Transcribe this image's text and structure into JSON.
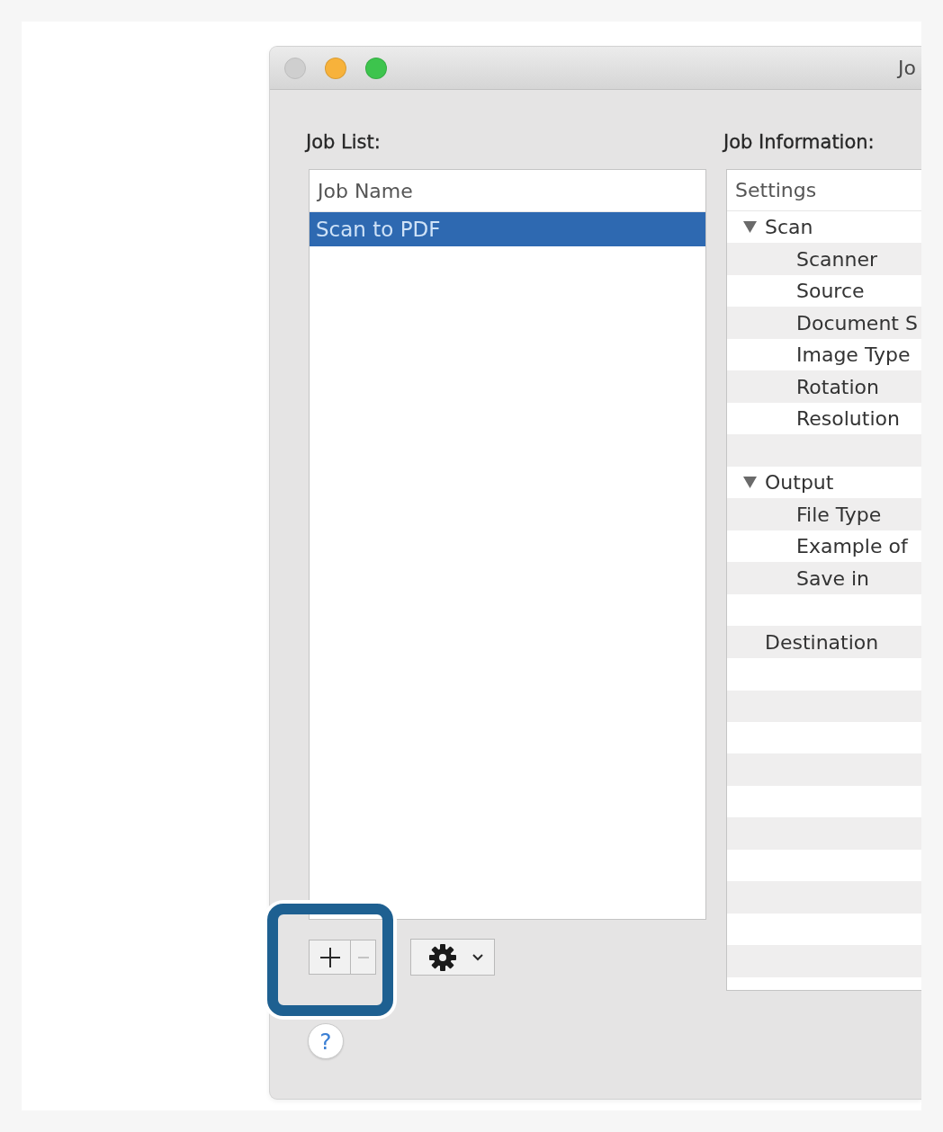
{
  "window": {
    "title": "Jo",
    "controls": [
      {
        "kind": "close",
        "disabled": true
      },
      {
        "kind": "minimize",
        "disabled": false
      },
      {
        "kind": "zoom",
        "disabled": false
      }
    ]
  },
  "job_list": {
    "label": "Job List:",
    "columns": [
      "Job Name"
    ],
    "rows": [
      {
        "name": "Scan to PDF",
        "selected": true
      }
    ]
  },
  "list_controls": [
    {
      "kind": "add",
      "disabled": false
    },
    {
      "kind": "remove",
      "disabled": true
    }
  ],
  "job_information": {
    "label": "Job Information:",
    "column": "Settings",
    "items": [
      {
        "label": "Scan",
        "expanded": true,
        "children": [
          {
            "label": "Scanner"
          },
          {
            "label": "Source"
          },
          {
            "label": "Document S"
          },
          {
            "label": "Image Type"
          },
          {
            "label": "Rotation"
          },
          {
            "label": "Resolution"
          }
        ]
      },
      {
        "label": "Output",
        "expanded": true,
        "children": [
          {
            "label": "File Type"
          },
          {
            "label": "Example of"
          },
          {
            "label": "Save in"
          }
        ]
      },
      {
        "label": "Destination"
      }
    ]
  },
  "help_button": {
    "label": "?"
  }
}
